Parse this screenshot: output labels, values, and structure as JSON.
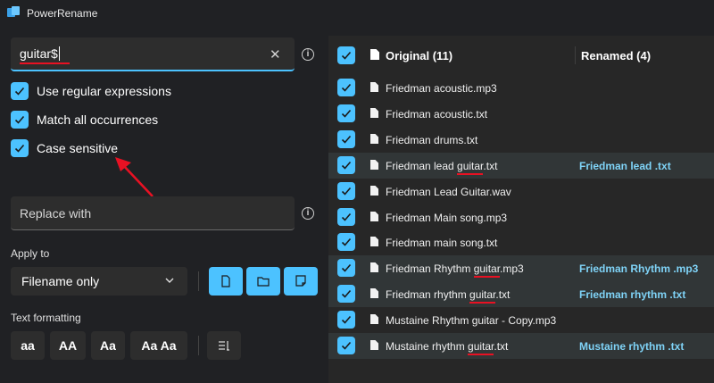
{
  "window": {
    "title": "PowerRename"
  },
  "search": {
    "value": "guitar$",
    "clear_icon": "close-icon"
  },
  "options": [
    {
      "label": "Use regular expressions",
      "checked": true
    },
    {
      "label": "Match all occurrences",
      "checked": true
    },
    {
      "label": "Case sensitive",
      "checked": true
    }
  ],
  "replace": {
    "placeholder": "Replace with"
  },
  "apply_to": {
    "label": "Apply to",
    "selected": "Filename only"
  },
  "text_formatting": {
    "label": "Text formatting",
    "buttons": [
      "aa",
      "AA",
      "Aa",
      "Aa Aa"
    ]
  },
  "list": {
    "original_header": "Original (11)",
    "renamed_header": "Renamed (4)",
    "rows": [
      {
        "original": "Friedman acoustic.mp3",
        "renamed": ""
      },
      {
        "original": "Friedman acoustic.txt",
        "renamed": ""
      },
      {
        "original": "Friedman drums.txt",
        "renamed": ""
      },
      {
        "original": "Friedman lead guitar.txt",
        "renamed": "Friedman lead .txt"
      },
      {
        "original": "Friedman Lead Guitar.wav",
        "renamed": ""
      },
      {
        "original": "Friedman Main song.mp3",
        "renamed": ""
      },
      {
        "original": "Friedman main song.txt",
        "renamed": ""
      },
      {
        "original": "Friedman Rhythm guitar.mp3",
        "renamed": "Friedman Rhythm .mp3"
      },
      {
        "original": "Friedman rhythm guitar.txt",
        "renamed": "Friedman rhythm .txt"
      },
      {
        "original": "Mustaine Rhythm guitar - Copy.mp3",
        "renamed": ""
      },
      {
        "original": "Mustaine rhythm guitar.txt",
        "renamed": "Mustaine rhythm .txt"
      }
    ]
  },
  "colors": {
    "accent": "#4cc2ff",
    "renamed_text": "#7fd3f7",
    "annotation_red": "#e81123"
  }
}
